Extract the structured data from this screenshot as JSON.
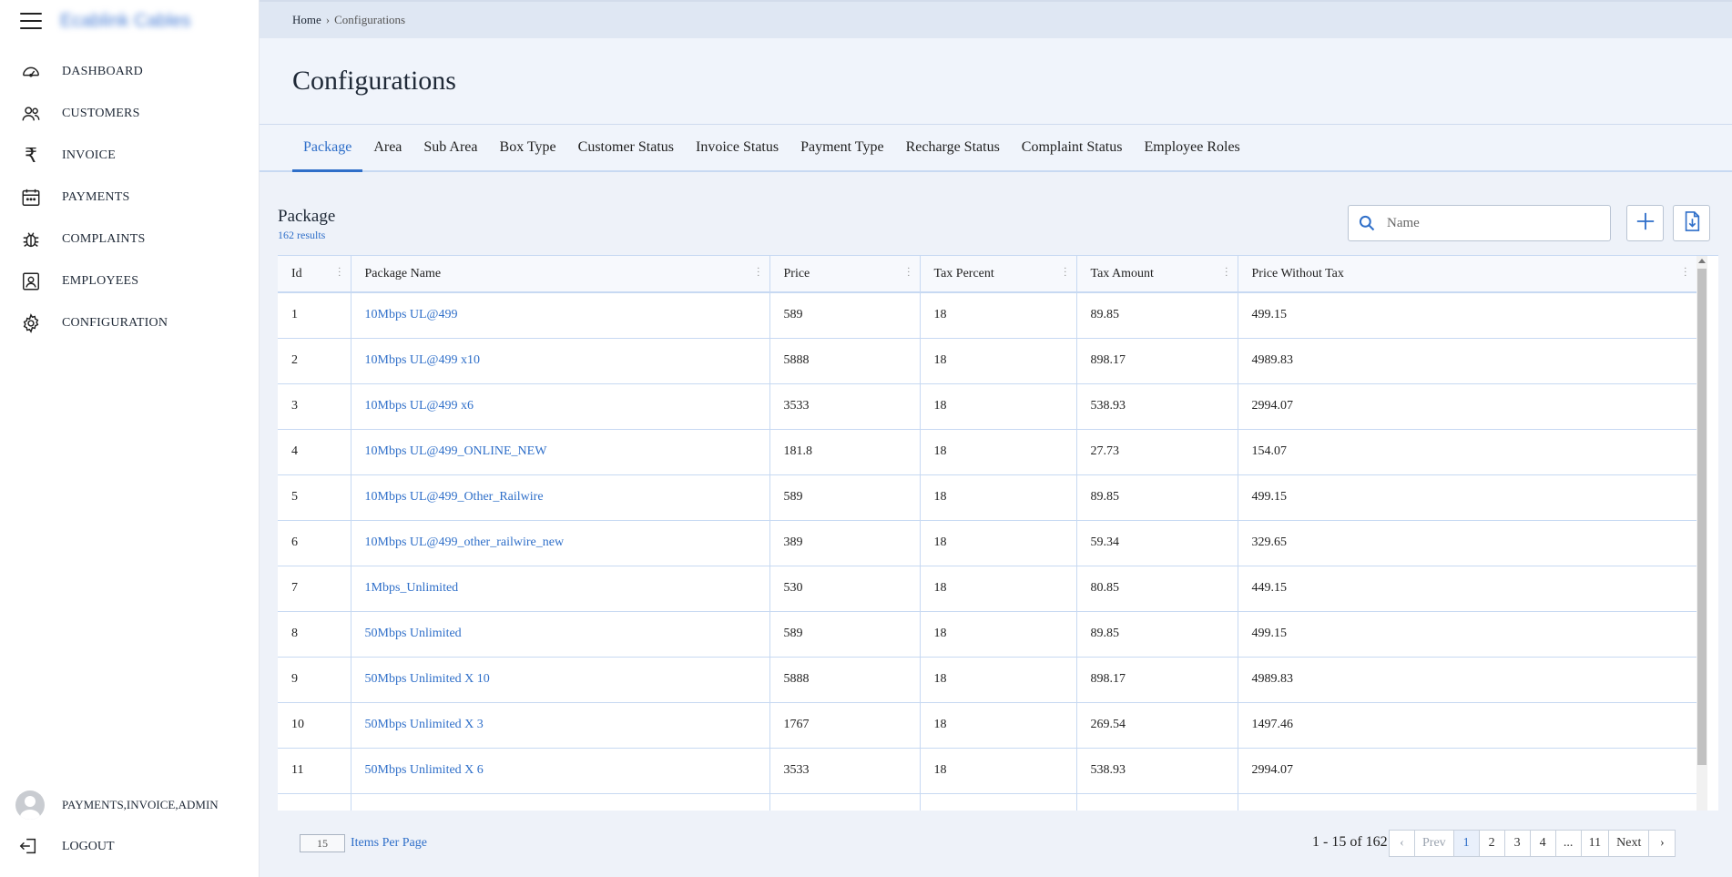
{
  "app": {
    "brand": "Ecablink Cables"
  },
  "sidebar": {
    "items": [
      {
        "label": "DASHBOARD",
        "icon": "dashboard-gauge-icon"
      },
      {
        "label": "CUSTOMERS",
        "icon": "users-icon"
      },
      {
        "label": "INVOICE",
        "icon": "rupee-icon"
      },
      {
        "label": "PAYMENTS",
        "icon": "calendar-icon"
      },
      {
        "label": "COMPLAINTS",
        "icon": "bug-icon"
      },
      {
        "label": "EMPLOYEES",
        "icon": "id-badge-icon"
      },
      {
        "label": "CONFIGURATION",
        "icon": "gear-icon"
      }
    ],
    "user": {
      "roles": "PAYMENTS,INVOICE,ADMIN"
    },
    "logout_label": "LOGOUT"
  },
  "breadcrumb": {
    "home": "Home",
    "sep": "›",
    "current": "Configurations"
  },
  "page": {
    "title": "Configurations"
  },
  "tabs": [
    {
      "label": "Package",
      "active": true
    },
    {
      "label": "Area"
    },
    {
      "label": "Sub Area"
    },
    {
      "label": "Box Type"
    },
    {
      "label": "Customer Status"
    },
    {
      "label": "Invoice Status"
    },
    {
      "label": "Payment Type"
    },
    {
      "label": "Recharge Status"
    },
    {
      "label": "Complaint Status"
    },
    {
      "label": "Employee Roles"
    }
  ],
  "panel": {
    "title": "Package",
    "count": "162 results",
    "search": {
      "placeholder": "Name",
      "value": ""
    }
  },
  "table": {
    "columns": [
      "Id",
      "Package Name",
      "Price",
      "Tax Percent",
      "Tax Amount",
      "Price Without Tax"
    ],
    "rows": [
      [
        "1",
        "10Mbps UL@499",
        "589",
        "18",
        "89.85",
        "499.15"
      ],
      [
        "2",
        "10Mbps UL@499 x10",
        "5888",
        "18",
        "898.17",
        "4989.83"
      ],
      [
        "3",
        "10Mbps UL@499 x6",
        "3533",
        "18",
        "538.93",
        "2994.07"
      ],
      [
        "4",
        "10Mbps UL@499_ONLINE_NEW",
        "181.8",
        "18",
        "27.73",
        "154.07"
      ],
      [
        "5",
        "10Mbps UL@499_Other_Railwire",
        "589",
        "18",
        "89.85",
        "499.15"
      ],
      [
        "6",
        "10Mbps UL@499_other_railwire_new",
        "389",
        "18",
        "59.34",
        "329.65"
      ],
      [
        "7",
        "1Mbps_Unlimited",
        "530",
        "18",
        "80.85",
        "449.15"
      ],
      [
        "8",
        "50Mbps Unlimited",
        "589",
        "18",
        "89.85",
        "499.15"
      ],
      [
        "9",
        "50Mbps Unlimited X 10",
        "5888",
        "18",
        "898.17",
        "4989.83"
      ],
      [
        "10",
        "50Mbps Unlimited X 3",
        "1767",
        "18",
        "269.54",
        "1497.46"
      ],
      [
        "11",
        "50Mbps Unlimited X 6",
        "3533",
        "18",
        "538.93",
        "2994.07"
      ],
      [
        "",
        "",
        "",
        "",
        "",
        ""
      ]
    ]
  },
  "footer": {
    "per_page_value": "15",
    "per_page_label": "Items Per Page",
    "range": "1 - 15 of 162",
    "pager": [
      "‹",
      "Prev",
      "1",
      "2",
      "3",
      "4",
      "...",
      "11",
      "Next",
      "›"
    ],
    "current_page": "1"
  },
  "colors": {
    "accent": "#2f6fc9",
    "border": "#c7d9f2",
    "background": "#eef2f9"
  }
}
